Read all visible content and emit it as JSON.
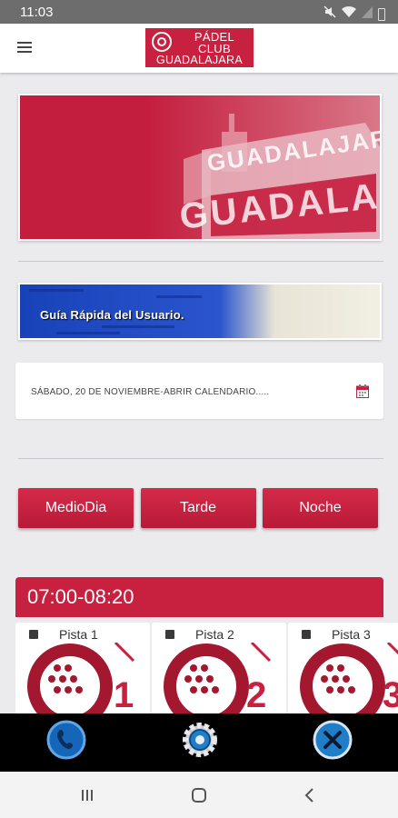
{
  "status_bar": {
    "time": "11:03"
  },
  "header": {
    "menu_icon": "hamburger-icon",
    "logo": {
      "line1": "PÁDEL",
      "line2": "CLUB",
      "line3": "GUADALAJARA"
    }
  },
  "hero": {
    "image_text": "GUADALAJARA"
  },
  "guide": {
    "label": "Guía Rápida del Usuario."
  },
  "date_selector": {
    "label": "SÁBADO, 20 DE NOVIEMBRE-ABRIR CALENDARIO.....",
    "icon": "calendar-icon"
  },
  "period_tabs": [
    {
      "label": "MedioDia"
    },
    {
      "label": "Tarde"
    },
    {
      "label": "Noche"
    }
  ],
  "time_slot": {
    "label": "07:00-08:20"
  },
  "courts": [
    {
      "label": "Pista 1",
      "number": "1"
    },
    {
      "label": "Pista 2",
      "number": "2"
    },
    {
      "label": "Pista 3",
      "number": "3"
    }
  ],
  "action_bar": {
    "icons": [
      "phone-icon",
      "gear-icon",
      "close-icon"
    ]
  },
  "colors": {
    "brand_red": "#c8203f",
    "action_blue": "#1e7fc8"
  }
}
